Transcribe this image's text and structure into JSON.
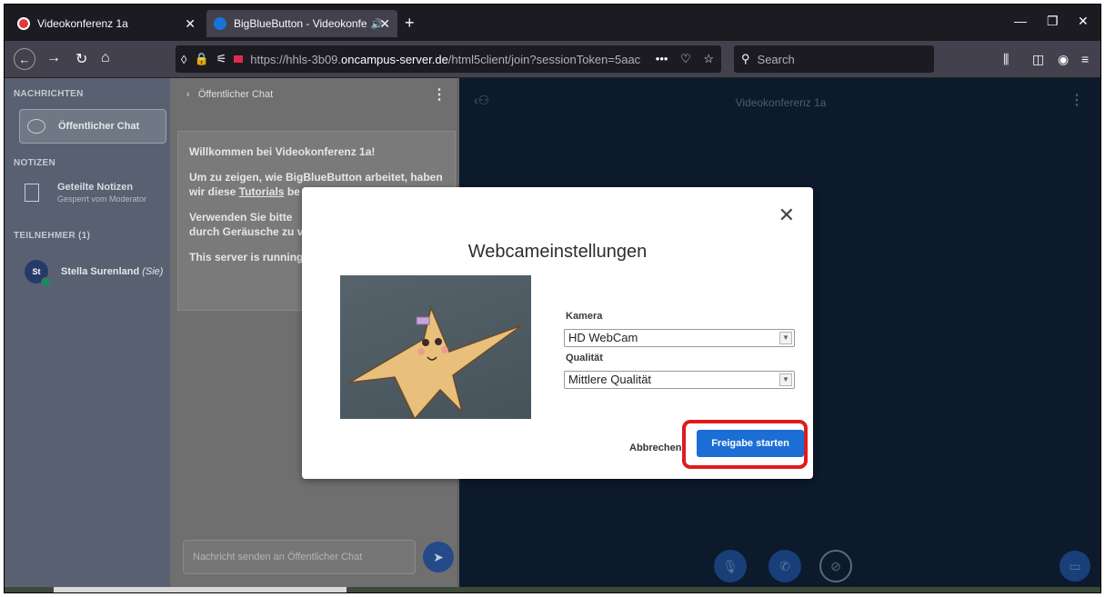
{
  "browser": {
    "tabs": [
      {
        "label": "Videokonferenz 1a",
        "close": "✕"
      },
      {
        "label": "BigBlueButton - Videokonfe",
        "audio": "🔊",
        "close": "✕"
      }
    ],
    "new_tab": "+",
    "url": {
      "prefix": "https://hhls-3b09.",
      "host": "oncampus-server.de",
      "path": "/html5client/join?sessionToken=5aac",
      "more": "•••"
    },
    "search_placeholder": "Search"
  },
  "sidebar": {
    "messages_heading": "NACHRICHTEN",
    "public_chat": "Öffentlicher Chat",
    "notes_heading": "NOTIZEN",
    "shared_notes": "Geteilte Notizen",
    "shared_notes_sub": "Gesperrt vom Moderator",
    "participants_heading": "TEILNEHMER (1)",
    "user_initials": "St",
    "user_name": "Stella Surenland",
    "user_you": "(Sie)"
  },
  "chat": {
    "header": "Öffentlicher Chat",
    "welcome_prefix": "Willkommen bei ",
    "welcome_name": "Videokonferenz 1a",
    "welcome_suffix": "!",
    "line2_a": "Um zu zeigen, wie BigBlueButton arbeitet, haben wir diese ",
    "line2_link": "Tutorials",
    "line2_b": " be",
    "line3": "Verwenden Sie bitte",
    "line3b": "durch Geräusche zu v",
    "line4": "This server is running",
    "input_placeholder": "Nachricht senden an Öffentlicher Chat"
  },
  "main": {
    "title": "Videokonferenz 1a"
  },
  "modal": {
    "title": "Webcameinstellungen",
    "camera_label": "Kamera",
    "camera_value": "HD WebCam",
    "quality_label": "Qualität",
    "quality_value": "Mittlere Qualität",
    "cancel": "Abbrechen",
    "start": "Freigabe starten"
  },
  "colors": {
    "primary": "#1b6ed6",
    "highlight": "#e01b1b",
    "main_bg": "#0c1a2c"
  }
}
